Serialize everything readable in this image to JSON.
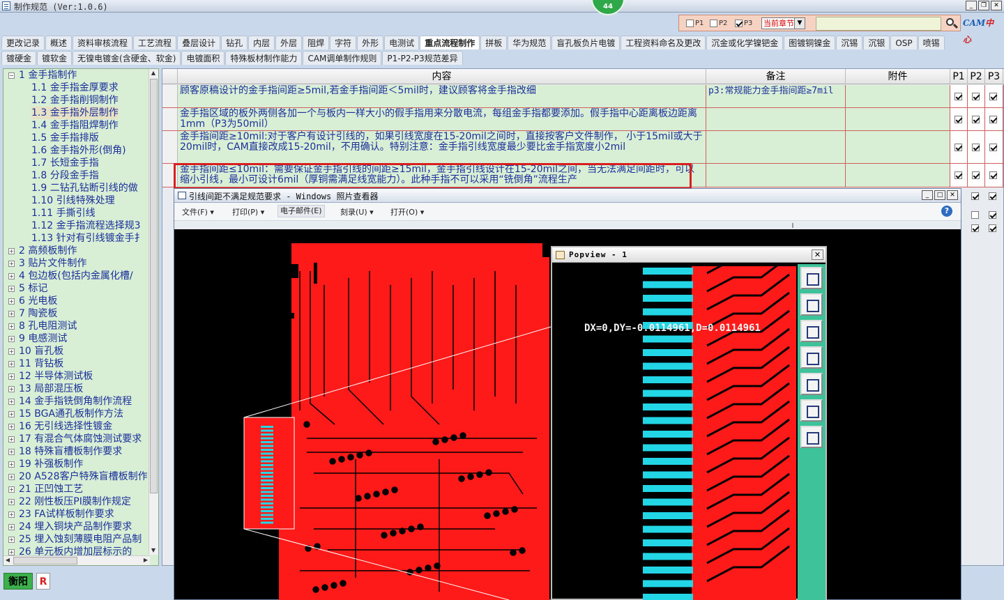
{
  "window": {
    "title": "制作规范 (Ver:1.0.6)",
    "notification_count": "44",
    "controls": [
      "_",
      "❐",
      "✕"
    ]
  },
  "filter": {
    "p1_label": "P1",
    "p1_checked": false,
    "p2_label": "P2",
    "p2_checked": false,
    "p3_label": "P3",
    "p3_checked": true,
    "chapter_value": "当前章节",
    "search_value": "",
    "logo_text_a": "CAM",
    "logo_text_b": "中心"
  },
  "tabs_row1": [
    "更改记录",
    "概述",
    "资料审核流程",
    "工艺流程",
    "叠层设计",
    "钻孔",
    "内层",
    "外层",
    "阻焊",
    "字符",
    "外形",
    "电测试",
    "重点流程制作",
    "拼板",
    "华为规范",
    "盲孔板负片电镀",
    "工程资料命名及更改",
    "沉金或化学镍钯金",
    "图镀铜镍金",
    "沉锡",
    "沉银",
    "OSP",
    "喷锡"
  ],
  "tabs_row2": [
    "镀硬金",
    "镀软金",
    "无镍电镀金(含硬金、软金)",
    "电镀面积",
    "特殊板材制作能力",
    "CAM调单制作规则",
    "P1-P2-P3规范差异"
  ],
  "active_tab": "重点流程制作",
  "tree": [
    {
      "label": "1 金手指制作",
      "level": 0,
      "expanded": true
    },
    {
      "label": "1.1 金手指金厚要求",
      "level": 1
    },
    {
      "label": "1.2 金手指削铜制作",
      "level": 1
    },
    {
      "label": "1.3 金手指外层制作",
      "level": 1,
      "selected": true
    },
    {
      "label": "1.4 金手指阻焊制作",
      "level": 1
    },
    {
      "label": "1.5 金手指排版",
      "level": 1
    },
    {
      "label": "1.6 金手指外形(倒角)",
      "level": 1
    },
    {
      "label": "1.7 长短金手指",
      "level": 1
    },
    {
      "label": "1.8 分段金手指",
      "level": 1
    },
    {
      "label": "1.9 二钻孔钻断引线的做",
      "level": 1
    },
    {
      "label": "1.10 引线特殊处理",
      "level": 1
    },
    {
      "label": "1.11 手撕引线",
      "level": 1
    },
    {
      "label": "1.12 金手指流程选择规3",
      "level": 1
    },
    {
      "label": "1.13 针对有引线镀金手扌",
      "level": 1
    },
    {
      "label": "2 高频板制作",
      "level": 0
    },
    {
      "label": "3 贴片文件制作",
      "level": 0
    },
    {
      "label": "4 包边板(包括内金属化槽/",
      "level": 0
    },
    {
      "label": "5 标记",
      "level": 0
    },
    {
      "label": "6 光电板",
      "level": 0
    },
    {
      "label": "7 陶瓷板",
      "level": 0
    },
    {
      "label": "8 孔电阻测试",
      "level": 0
    },
    {
      "label": "9 电感测试",
      "level": 0
    },
    {
      "label": "10 盲孔板",
      "level": 0
    },
    {
      "label": "11 背钻板",
      "level": 0
    },
    {
      "label": "12 半导体测试板",
      "level": 0
    },
    {
      "label": "13 局部混压板",
      "level": 0
    },
    {
      "label": "14 金手指铣倒角制作流程",
      "level": 0
    },
    {
      "label": "15 BGA通孔板制作方法",
      "level": 0
    },
    {
      "label": "16 无引线选择性镀金",
      "level": 0
    },
    {
      "label": "17 有混合气体腐蚀测试要求",
      "level": 0
    },
    {
      "label": "18 特殊盲槽板制作要求",
      "level": 0
    },
    {
      "label": "19 补强板制作",
      "level": 0
    },
    {
      "label": "20 A528客户特殊盲槽板制作",
      "level": 0
    },
    {
      "label": "21 正凹蚀工艺",
      "level": 0
    },
    {
      "label": "22 刚性板压PI膜制作规定",
      "level": 0
    },
    {
      "label": "23 FA试样板制作要求",
      "level": 0
    },
    {
      "label": "24 埋入铜块产品制作要求",
      "level": 0
    },
    {
      "label": "25 埋入蚀刻薄膜电阻产品制",
      "level": 0
    },
    {
      "label": "26 单元板内增加层标示的",
      "level": 0
    }
  ],
  "grid": {
    "headers": {
      "content": "内容",
      "remark": "备注",
      "attachment": "附件",
      "p1": "P1",
      "p2": "P2",
      "p3": "P3"
    },
    "rows": [
      {
        "content": "顾客原稿设计的金手指间距≥5mil,若金手指间距＜5mil时，建议顾客将金手指改细",
        "remark": "p3:常规能力金手指间距≥7mil",
        "p1": true,
        "p2": true,
        "p3": true
      },
      {
        "content": "金手指区域的板外两侧各加一个与板内一样大小的假手指用来分散电流，每组金手指都要添加。假手指中心距离板边距离1mm（P3为50mil）",
        "remark": "",
        "p1": true,
        "p2": true,
        "p3": true
      },
      {
        "content": "金手指间距≥10mil:对于客户有设计引线的，如果引线宽度在15-20mil之间时，直接按客户文件制作， 小于15mil或大于20mil时，CAM直接改成15-20mil，不用确认。特别注意：金手指引线宽度最少要比金手指宽度小2mil",
        "remark": "",
        "p1": true,
        "p2": true,
        "p3": true
      },
      {
        "content": "金手指间距≤10mil：需要保证金手指引线的间距≥15mil，金手指引线设计在15-20mil之间，当无法满足间距时，可以缩小引线，最小可设计6mil（厚铜需满足线宽能力）。此种手指不可以采用“铣倒角”流程生产",
        "remark": "",
        "p1": true,
        "p2": true,
        "p3": true
      }
    ],
    "hidden_rows_checks": [
      {
        "p2": true,
        "p3": true
      },
      {
        "p2": false,
        "p3": true
      },
      {
        "p2": true,
        "p3": true
      }
    ]
  },
  "viewer": {
    "title": "引线间距不满足规范要求 - Windows 照片查看器",
    "menu": [
      "文件(F)",
      "打印(P)",
      "电子邮件(E)",
      "刻录(U)",
      "打开(O)"
    ],
    "help": "?",
    "controls": [
      "_",
      "□",
      "✕"
    ]
  },
  "popview": {
    "title": "Popview - 1",
    "close": "✕",
    "measurement": "DX=0,DY=-0.0114961,D=0.0114961",
    "tools": [
      "zoom-fit-icon",
      "pan-up-icon",
      "pan-down-icon",
      "pan-left-icon",
      "pan-right-icon",
      "zoom-in-icon",
      "zoom-out-icon"
    ]
  },
  "status": {
    "city": "衡阳",
    "mode": "R"
  },
  "colors": {
    "copper": "#ff1a1a",
    "gold_finger": "#22d6e6",
    "board_bg": "#000000",
    "highlight": "#d81e1e",
    "grid_row": "#d9efd5"
  }
}
